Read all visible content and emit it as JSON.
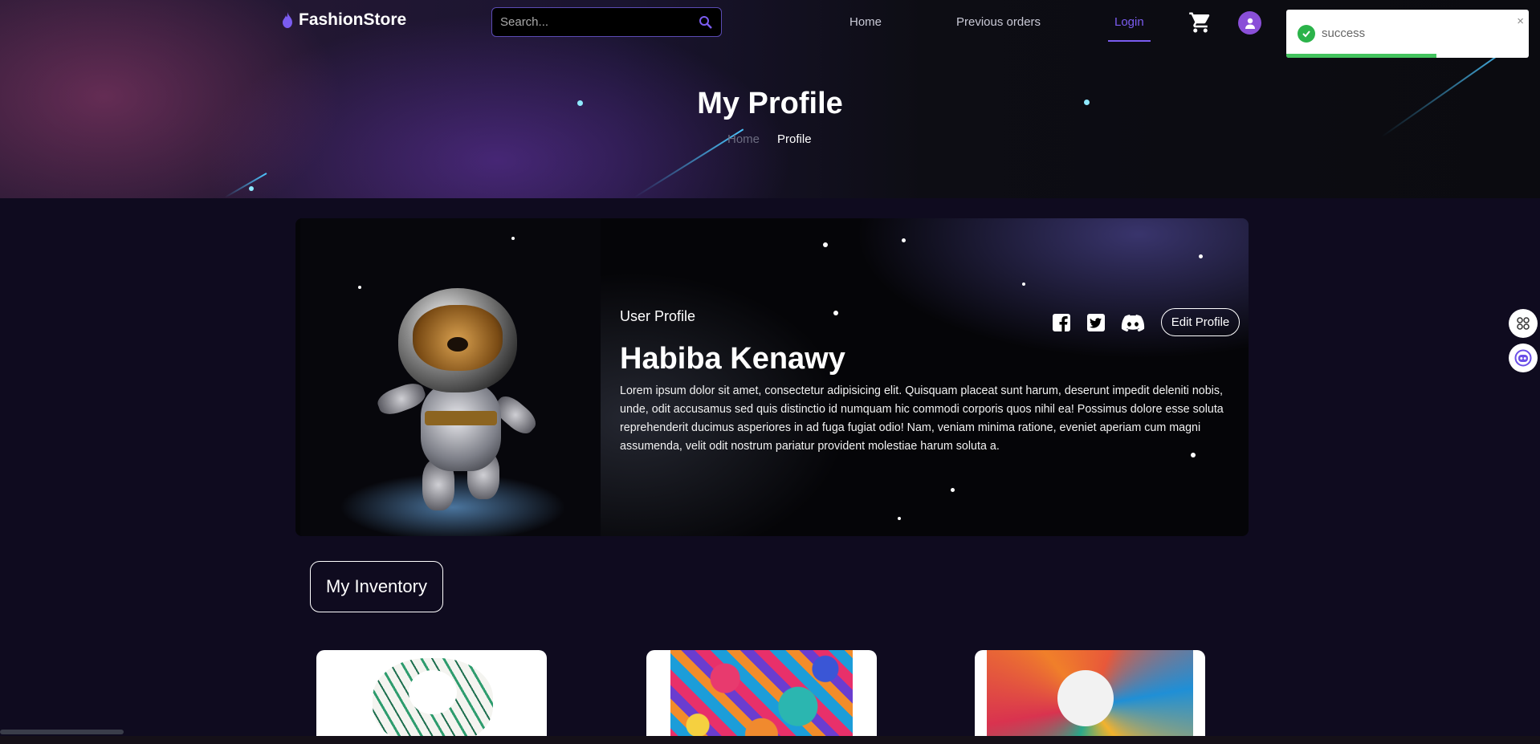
{
  "navbar": {
    "brand": "FashionStore",
    "search_placeholder": "Search...",
    "links": {
      "home": "Home",
      "previous_orders": "Previous orders",
      "login": "Login"
    }
  },
  "hero": {
    "title": "My Profile",
    "breadcrumb": {
      "home": "Home",
      "current": "Profile"
    }
  },
  "toast": {
    "message": "success",
    "close": "×",
    "progress": 0.62
  },
  "profile": {
    "subtitle": "User Profile",
    "name": "Habiba Kenawy",
    "bio": "Lorem ipsum dolor sit amet, consectetur adipisicing elit. Quisquam placeat sunt harum, deserunt impedit deleniti nobis, unde, odit accusamus sed quis distinctio id numquam hic commodi corporis quos nihil ea! Possimus dolore esse soluta reprehenderit ducimus asperiores in ad fuga fugiat odio! Nam, veniam minima ratione, eveniet aperiam cum magni assumenda, velit odit nostrum pariatur provident molestiae harum soluta a.",
    "edit_button": "Edit Profile",
    "social_icons": [
      "facebook-icon",
      "twitter-icon",
      "discord-icon"
    ]
  },
  "inventory": {
    "button": "My Inventory",
    "products": [
      {
        "image": "white-green-scarf"
      },
      {
        "image": "multicolor-floral-scarf"
      },
      {
        "image": "geometric-orange-blue-scarf"
      }
    ]
  },
  "colors": {
    "accent": "#7b5cf0",
    "success": "#2bb34a",
    "background": "#0f0b1f"
  }
}
